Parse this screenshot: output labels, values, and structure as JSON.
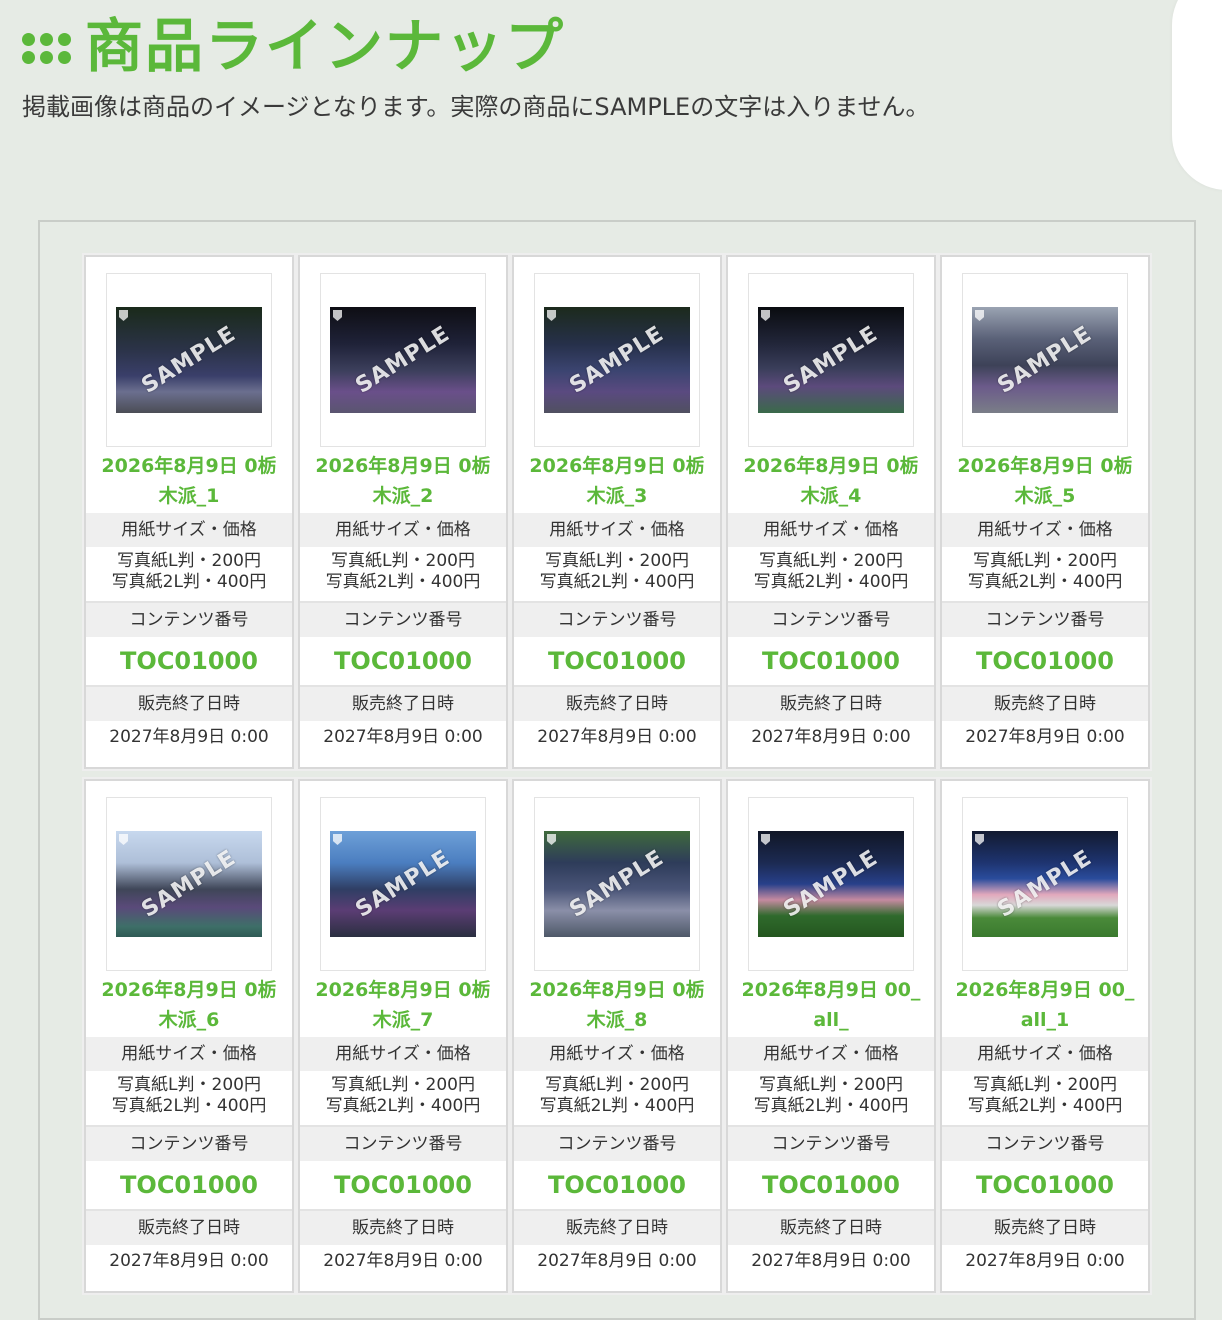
{
  "header": {
    "title": "商品ラインナップ",
    "subtitle": "掲載画像は商品のイメージとなります。実際の商品にSAMPLEの文字は入りません。"
  },
  "colors": {
    "accent": "#5bb83a",
    "background": "#e6ebe5",
    "header_row": "#efefef"
  },
  "labels": {
    "watermark": "SAMPLE",
    "size_price": "用紙サイズ・価格",
    "content_no": "コンテンツ番号",
    "end_time": "販売終了日時"
  },
  "products": [
    {
      "name": "2026年8月9日 0栃木派_1",
      "price_l": "写真紙L判・200円",
      "price_2l": "写真紙2L判・400円",
      "code": "TOC01000",
      "end": "2027年8月9日 0:00"
    },
    {
      "name": "2026年8月9日 0栃木派_2",
      "price_l": "写真紙L判・200円",
      "price_2l": "写真紙2L判・400円",
      "code": "TOC01000",
      "end": "2027年8月9日 0:00"
    },
    {
      "name": "2026年8月9日 0栃木派_3",
      "price_l": "写真紙L判・200円",
      "price_2l": "写真紙2L判・400円",
      "code": "TOC01000",
      "end": "2027年8月9日 0:00"
    },
    {
      "name": "2026年8月9日 0栃木派_4",
      "price_l": "写真紙L判・200円",
      "price_2l": "写真紙2L判・400円",
      "code": "TOC01000",
      "end": "2027年8月9日 0:00"
    },
    {
      "name": "2026年8月9日 0栃木派_5",
      "price_l": "写真紙L判・200円",
      "price_2l": "写真紙2L判・400円",
      "code": "TOC01000",
      "end": "2027年8月9日 0:00"
    },
    {
      "name": "2026年8月9日 0栃木派_6",
      "price_l": "写真紙L判・200円",
      "price_2l": "写真紙2L判・400円",
      "code": "TOC01000",
      "end": "2027年8月9日 0:00"
    },
    {
      "name": "2026年8月9日 0栃木派_7",
      "price_l": "写真紙L判・200円",
      "price_2l": "写真紙2L判・400円",
      "code": "TOC01000",
      "end": "2027年8月9日 0:00"
    },
    {
      "name": "2026年8月9日 0栃木派_8",
      "price_l": "写真紙L判・200円",
      "price_2l": "写真紙2L判・400円",
      "code": "TOC01000",
      "end": "2027年8月9日 0:00"
    },
    {
      "name": "2026年8月9日 00_all_",
      "price_l": "写真紙L判・200円",
      "price_2l": "写真紙2L判・400円",
      "code": "TOC01000",
      "end": "2027年8月9日 0:00"
    },
    {
      "name": "2026年8月9日 00_all_1",
      "price_l": "写真紙L判・200円",
      "price_2l": "写真紙2L判・400円",
      "code": "TOC01000",
      "end": "2027年8月9日 0:00"
    }
  ]
}
